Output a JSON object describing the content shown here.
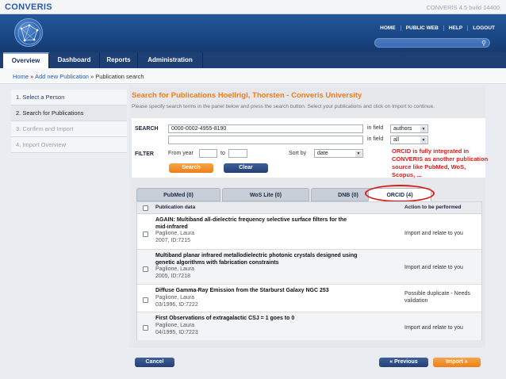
{
  "app": {
    "brand": "CONVERIS",
    "build": "CONVERIS 4.5 build 14400"
  },
  "topnav": [
    "HOME",
    "PUBLIC WEB",
    "HELP",
    "LOGOUT"
  ],
  "tabs": [
    "Overview",
    "Dashboard",
    "Reports",
    "Administration"
  ],
  "breadcrumb": {
    "home": "Home",
    "sep1": "»",
    "add": "Add new Publication",
    "sep2": "»",
    "current": "Publication search"
  },
  "steps": [
    "1. Select a Person",
    "2. Search for Publications",
    "3. Confirm and Import",
    "4. Import Overview"
  ],
  "page": {
    "title": "Search for Publications Hoellrigl, Thorsten - Converis University",
    "subtitle": "Please specify search terms in the panel below and press the search button. Select your publications and click on Import to continue."
  },
  "form": {
    "search_label": "SEARCH",
    "search_value1": "0000-0002-4955-8190",
    "search_value2": "",
    "infield_label": "in field",
    "field1": "authors",
    "field2": "all",
    "filter_label": "FILTER",
    "from_year": "From year",
    "to": "to",
    "sortby": "Sort by",
    "sort_value": "date",
    "search_button": "Search",
    "clear_button": "Clear"
  },
  "annotation": "ORCID is fully integrated in CONVERIS as another publication source like PubMed, WoS, Scopus, ...",
  "source_tabs": [
    "PubMed (0)",
    "WoS Lite (0)",
    "DNB (0)",
    "ORCID (4)"
  ],
  "table": {
    "headers": {
      "data": "Publication data",
      "action": "Action to be performed"
    },
    "rows": [
      {
        "title1": "AGAIN: Multiband all-dielectric frequency selective surface filters for the",
        "title2": "mid-infrared",
        "author": "Paglione, Laura",
        "date": "2007, ID:7215",
        "action1": "Import and relate to you",
        "action2": ""
      },
      {
        "title1": "Multiband planar infrared metallodielectric photonic crystals designed using",
        "title2": "genetic algorithms with fabrication constraints",
        "author": "Paglione, Laura",
        "date": "2005, ID:7218",
        "action1": "Import and relate to you",
        "action2": ""
      },
      {
        "title1": "Diffuse Gamma-Ray Emission from the Starburst Galaxy NGC 253",
        "title2": "",
        "author": "Paglione, Laura",
        "date": "03/1996, ID:7222",
        "action1": "Possible duplicate - Needs",
        "action2": "validation"
      },
      {
        "title1": "First Observations of extragalactic CSJ = 1 goes to 0",
        "title2": "",
        "author": "Paglione, Laura",
        "date": "04/1995, ID:7223",
        "action1": "Import and relate to you",
        "action2": ""
      }
    ]
  },
  "buttons": {
    "cancel": "Cancel",
    "previous": "«  Previous",
    "import": "Import  »"
  },
  "colors": {
    "accent_orange": "#f07d1c",
    "navy": "#1d3f73",
    "annotation_red": "#d81d1d"
  }
}
